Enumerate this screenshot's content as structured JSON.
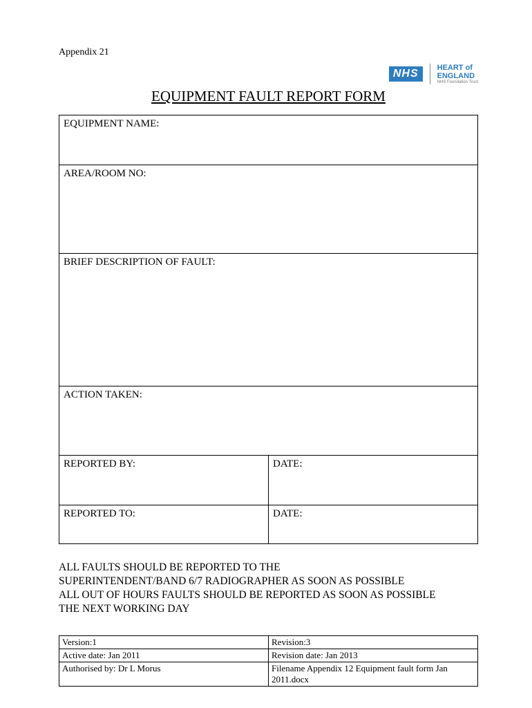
{
  "header": {
    "appendix": "Appendix 21",
    "nhs_label": "NHS",
    "heart_line1": "HEART of",
    "heart_line2": "ENGLAND",
    "heart_line3": "NHS Foundation Trust"
  },
  "title": "EQUIPMENT FAULT REPORT FORM",
  "fields": {
    "equipment_name": "EQUIPMENT NAME:",
    "area_room_no": "AREA/ROOM NO:",
    "brief_description": "BRIEF DESCRIPTION OF FAULT:",
    "action_taken": "ACTION TAKEN:",
    "reported_by": "REPORTED BY:",
    "reported_by_date": "DATE:",
    "reported_to": "REPORTED TO:",
    "reported_to_date": "DATE:"
  },
  "notice": {
    "line1": "ALL FAULTS SHOULD BE REPORTED TO THE",
    "line2": "SUPERINTENDENT/BAND 6/7 RADIOGRAPHER AS SOON AS POSSIBLE",
    "line3": "ALL OUT OF HOURS FAULTS SHOULD BE REPORTED AS SOON AS POSSIBLE",
    "line4": "THE NEXT WORKING DAY"
  },
  "footer": {
    "version": "Version:1",
    "revision": "Revision:3",
    "active_date": "Active date: Jan 2011",
    "revision_date": "Revision date: Jan 2013",
    "authorised_by": "Authorised by: Dr L Morus",
    "filename": "Filename Appendix 12 Equipment fault form Jan 2011.docx"
  }
}
